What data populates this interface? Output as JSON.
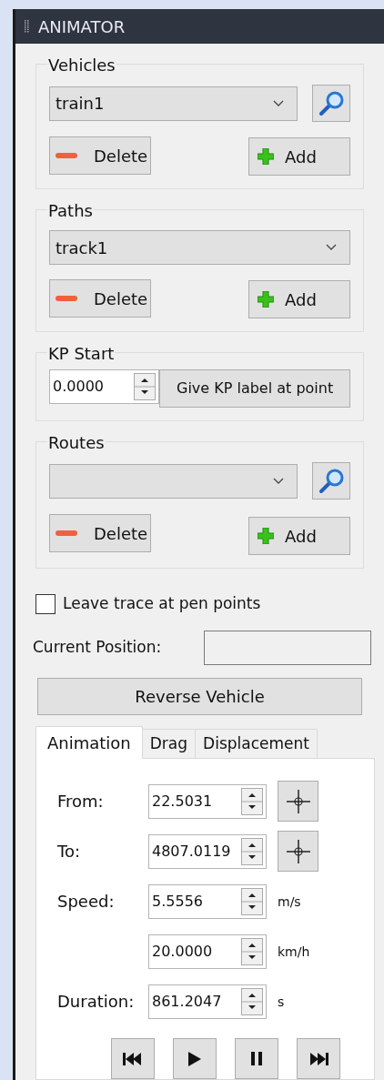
{
  "panel": {
    "title": "ANIMATOR"
  },
  "groups": [
    {
      "label": "Vehicles",
      "value": "train1",
      "has_search": true,
      "delete": "Delete",
      "add": "Add"
    },
    {
      "label": "Paths",
      "value": "track1",
      "has_search": false,
      "delete": "Delete",
      "add": "Add"
    },
    {
      "label": "KP Start",
      "kind": "kp",
      "value": "0.0000",
      "button": "Give KP label at point"
    },
    {
      "label": "Routes",
      "has_search": true,
      "delete": "Delete",
      "add": "Add"
    }
  ],
  "trace": {
    "label": "Leave trace at pen points",
    "checked": false
  },
  "current_position": {
    "label": "Current Position:"
  },
  "reverse_button": "Reverse Vehicle",
  "tabs": [
    {
      "label": "Animation",
      "selected": true
    },
    {
      "label": "Drag",
      "selected": false
    },
    {
      "label": "Displacement",
      "selected": false
    }
  ],
  "animation": [
    {
      "label": "From:",
      "value": "22.5031",
      "kind": "pick"
    },
    {
      "label": "To:",
      "value": "4807.0119",
      "kind": "pick"
    },
    {
      "label": "Speed:",
      "value": "5.5556",
      "kind": "unit",
      "unit": "m/s"
    },
    {
      "value": "20.0000",
      "kind": "unit",
      "unit": "km/h"
    },
    {
      "label": "Duration:",
      "value": "861.2047",
      "kind": "unit",
      "unit": "s"
    }
  ]
}
